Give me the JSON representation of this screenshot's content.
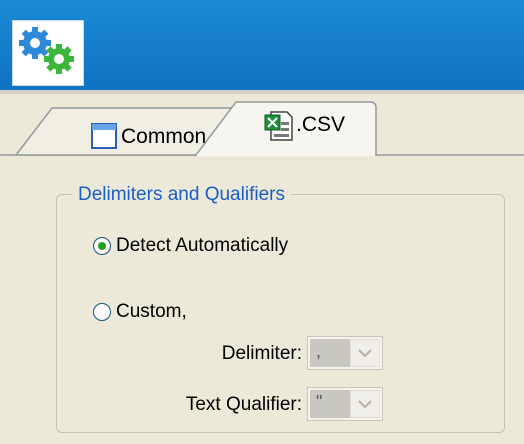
{
  "app": {
    "logo_icon": "gears-icon",
    "colors": {
      "header": "#1482cf",
      "accent_blue": "#1a5fc8",
      "radio_dot": "#21a121"
    }
  },
  "tabs": [
    {
      "label": "Common",
      "icon": "window-icon",
      "selected": false
    },
    {
      "label": ".CSV",
      "icon": "excel-file-icon",
      "selected": true
    }
  ],
  "group": {
    "title": "Delimiters and Qualifiers",
    "options": [
      {
        "label": "Detect Automatically",
        "checked": true
      },
      {
        "label": "Custom,",
        "checked": false
      }
    ],
    "delimiter": {
      "label": "Delimiter:",
      "value": ","
    },
    "qualifier": {
      "label": "Text Qualifier:",
      "value": "\""
    }
  }
}
